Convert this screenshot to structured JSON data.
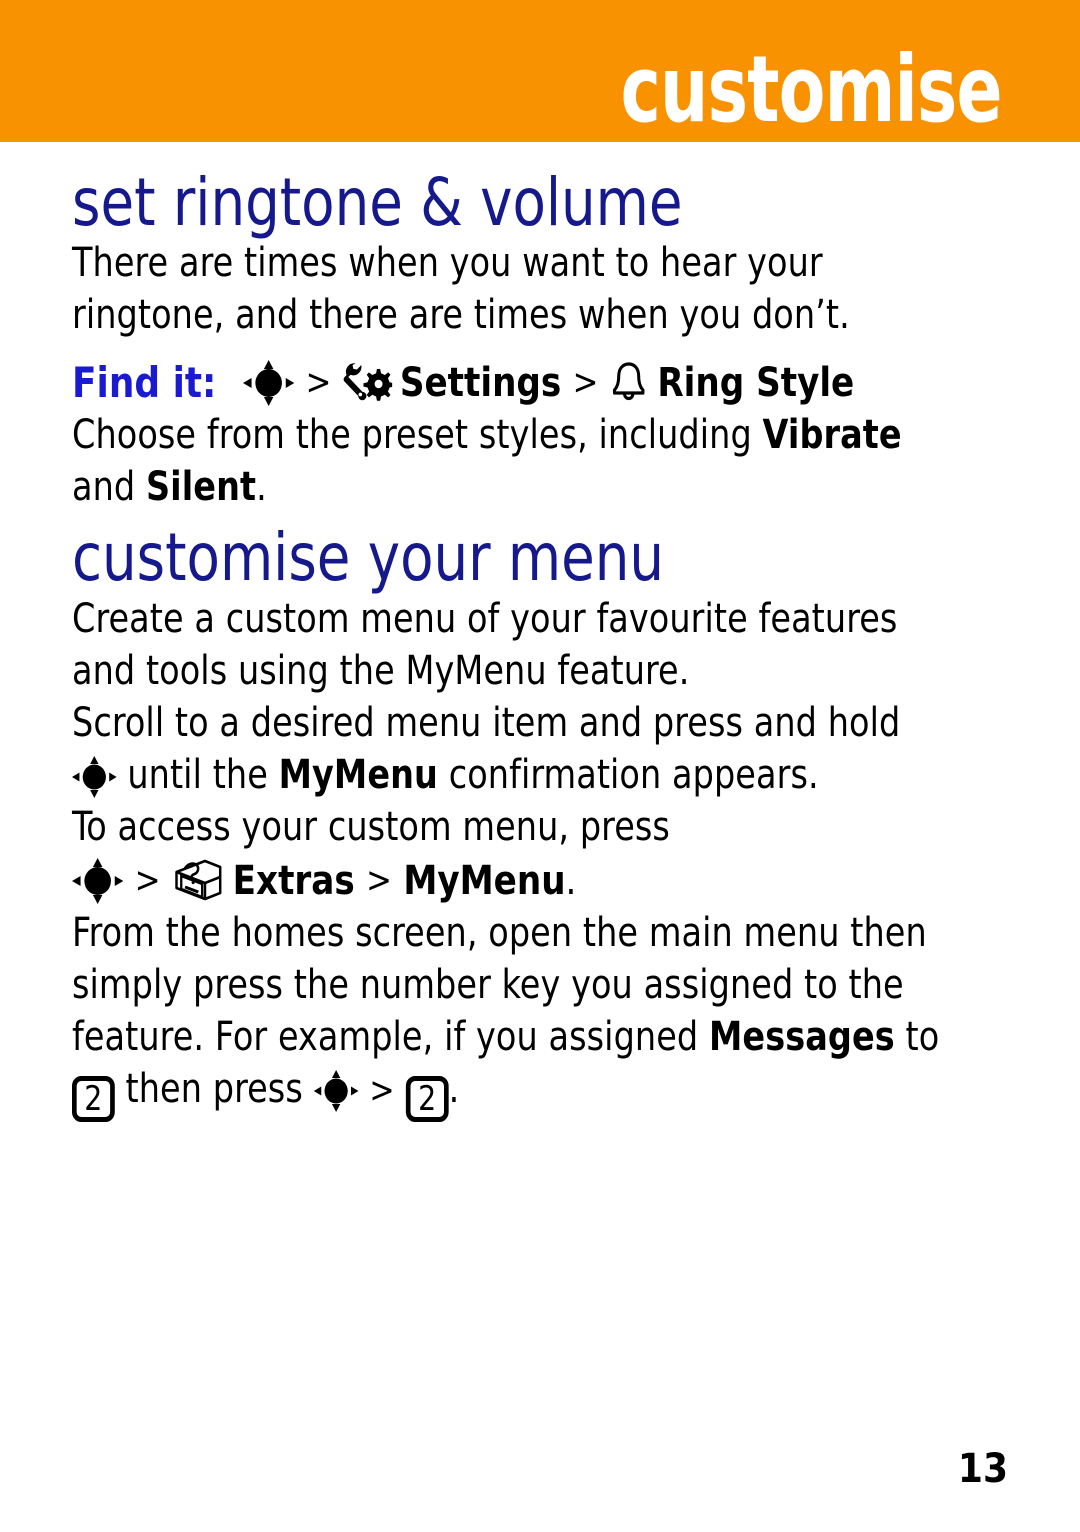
{
  "banner": {
    "chapter_title": "customise",
    "background_color": "#f99200",
    "text_color": "#ffffff"
  },
  "heading_color": "#15198c",
  "sections": [
    {
      "heading": "set ringtone & volume",
      "intro": "There are times when you want to hear your ringtone, and there are times when you don’t.",
      "find_it": {
        "label": "Find it:",
        "label_color": "#1a1ad0",
        "path": [
          {
            "type": "icon",
            "icon": "nav-key-icon"
          },
          {
            "type": "separator",
            "text": ">"
          },
          {
            "type": "icon",
            "icon": "settings-gear-wrench-icon"
          },
          {
            "type": "label",
            "text": "Settings"
          },
          {
            "type": "separator",
            "text": ">"
          },
          {
            "type": "icon",
            "icon": "bell-icon"
          },
          {
            "type": "label",
            "text": "Ring Style"
          }
        ]
      },
      "body_pre": "Choose from the preset styles, including ",
      "body_bold_1": "Vibrate",
      "body_mid": " and ",
      "body_bold_2": "Silent",
      "body_end": "."
    },
    {
      "heading": "customise your menu",
      "paragraph_1": "Create a custom menu of your favourite features and tools using the MyMenu feature.",
      "paragraph_2_pre": "Scroll to a desired menu item and press and hold ",
      "paragraph_2_mid": " until the ",
      "paragraph_2_bold": "MyMenu",
      "paragraph_2_end": " confirmation appears.",
      "paragraph_3_pre": "To access your custom menu, press",
      "paragraph_3_path": [
        {
          "type": "icon",
          "icon": "nav-key-icon"
        },
        {
          "type": "separator",
          "text": ">"
        },
        {
          "type": "icon",
          "icon": "extras-box-icon"
        },
        {
          "type": "label",
          "text": "Extras"
        },
        {
          "type": "separator",
          "text": ">"
        },
        {
          "type": "label",
          "text": "MyMenu"
        },
        {
          "type": "period",
          "text": "."
        }
      ],
      "paragraph_4_pre": "From the homes screen, open the main menu then simply press the number key you assigned to the feature. For example, if you assigned ",
      "paragraph_4_bold": "Messages",
      "paragraph_4_mid": " to ",
      "paragraph_4_key_1": "2",
      "paragraph_4_post": " then press ",
      "paragraph_4_sep": ">",
      "paragraph_4_key_2": "2",
      "paragraph_4_end": "."
    }
  ],
  "footer": {
    "page_number": "13"
  }
}
